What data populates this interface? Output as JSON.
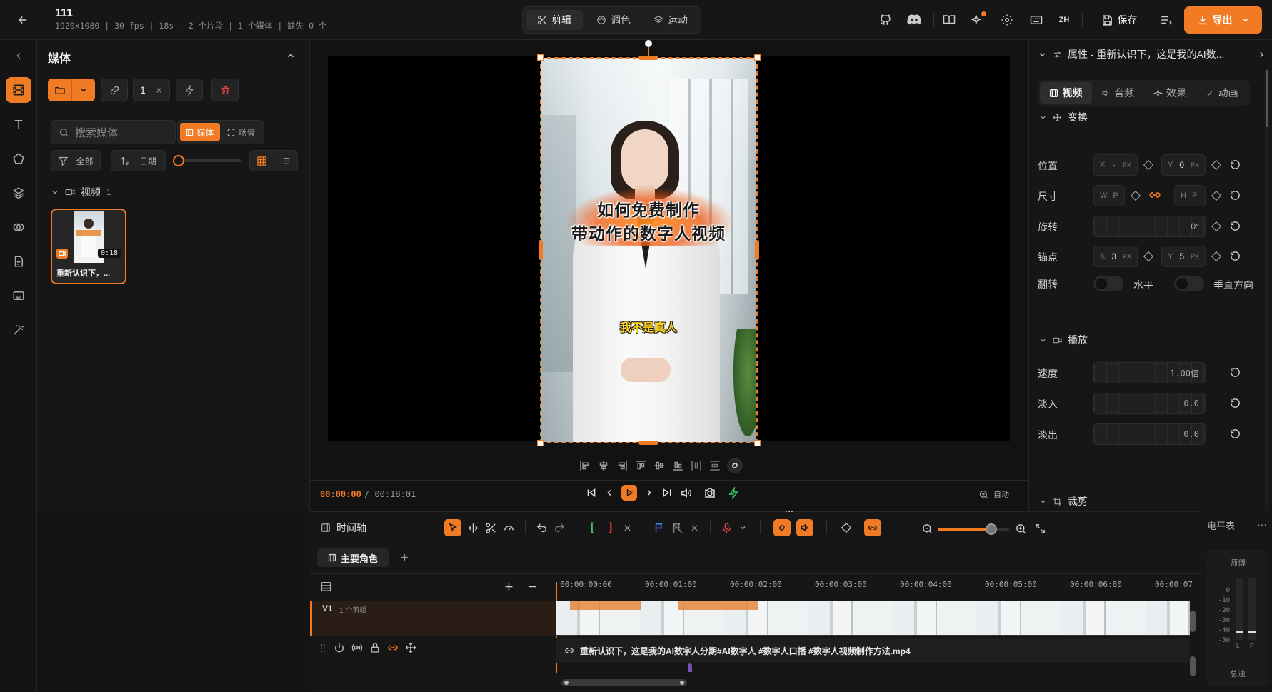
{
  "project": {
    "name": "111",
    "meta": "1920x1080 | 30 fps | 18s | 2 个片段 | 1 个媒体 | 缺失 0 个"
  },
  "modes": [
    {
      "label": "剪辑",
      "icon": "scissors-icon",
      "active": true
    },
    {
      "label": "调色",
      "icon": "palette-icon",
      "active": false
    },
    {
      "label": "运动",
      "icon": "layers-icon",
      "active": false
    }
  ],
  "header": {
    "lang": "ZH",
    "save_label": "保存",
    "export_label": "导出"
  },
  "media_panel": {
    "title": "媒体",
    "count_value": "1",
    "search_placeholder": "搜索媒体",
    "tab_media": "媒体",
    "tab_scene": "场景",
    "filter_label": "全部",
    "sort_label": "日期",
    "group_label": "视频",
    "group_count": "1",
    "thumb_duration": "0:18",
    "thumb_title": "重新认识下，..."
  },
  "preview": {
    "overlay_title_line1": "如何免费制作",
    "overlay_title_line2": "带动作的数字人视频",
    "overlay_subtitle": "我不是真人",
    "timecode_current": "00:00:00",
    "timecode_total": "/ 00:18:01",
    "zoom_label": "自动"
  },
  "properties": {
    "header": "属性 - 重新认识下，这是我的AI数...",
    "tabs": [
      "视频",
      "音频",
      "效果",
      "动画"
    ],
    "transform_title": "变换",
    "position_label": "位置",
    "pos_x": "-",
    "pos_y": "0",
    "size_label": "尺寸",
    "size_w_prefix": "W",
    "size_w": "P",
    "size_h_prefix": "H",
    "size_h": "P",
    "rotation_label": "旋转",
    "rotation_value": "0°",
    "anchor_label": "锚点",
    "anchor_x": "3",
    "anchor_y": "5",
    "flip_label": "翻转",
    "flip_h": "水平",
    "flip_v": "垂直方向",
    "playback_title": "播放",
    "speed_label": "速度",
    "speed_value": "1.00倍",
    "fadein_label": "淡入",
    "fadein_value": "0.0",
    "fadeout_label": "淡出",
    "fadeout_value": "0.0",
    "crop_title": "裁剪",
    "unit_px": "PX"
  },
  "timeline": {
    "title": "时间轴",
    "sequence_tab": "主要角色",
    "track_name": "V1",
    "track_clips": "1 个剪辑",
    "ruler": [
      "00:00:00:00",
      "00:00:01:00",
      "00:00:02:00",
      "00:00:03:00",
      "00:00:04:00",
      "00:00:05:00",
      "00:00:06:00",
      "00:00:07"
    ],
    "clip_name": "重新认识下，这是我的AI数字人分期#AI数字人 #数字人口播 #数字人视频制作方法.mp4",
    "zoom_level": 0.75
  },
  "meter": {
    "title": "电平表",
    "mode": "师傅",
    "scale": [
      "0",
      "-10",
      "-20",
      "-30",
      "-40",
      "-50"
    ],
    "channel_l": "L",
    "channel_r": "R",
    "master_label": "总速"
  },
  "colors": {
    "accent": "#f07b24",
    "background": "#141414",
    "panel": "#161616"
  }
}
